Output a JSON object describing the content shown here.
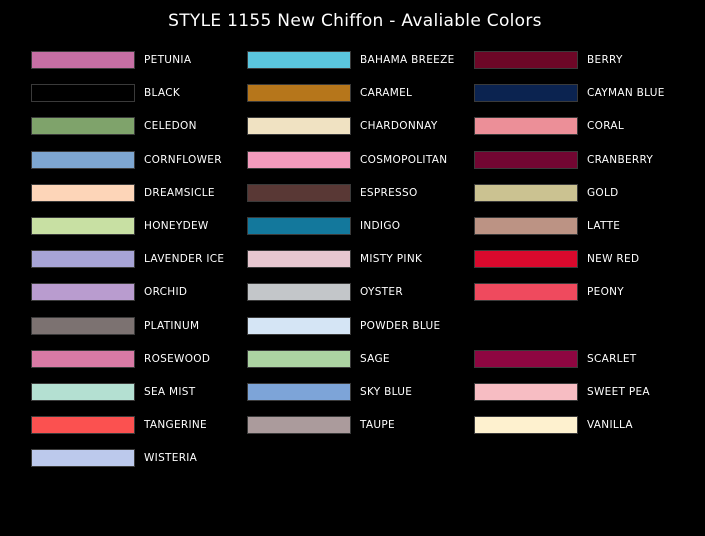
{
  "title": "STYLE 1155 New Chiffon - Avaliable Colors",
  "columns": [
    [
      {
        "name": "PETUNIA",
        "color": "#c66fa4"
      },
      {
        "name": "BLACK",
        "color": "#000000"
      },
      {
        "name": "CELEDON",
        "color": "#7fa36b"
      },
      {
        "name": "CORNFLOWER",
        "color": "#7ea6d0"
      },
      {
        "name": "DREAMSICLE",
        "color": "#fdd5b8"
      },
      {
        "name": "HONEYDEW",
        "color": "#c8e0a3"
      },
      {
        "name": "LAVENDER ICE",
        "color": "#a7a4d6"
      },
      {
        "name": "ORCHID",
        "color": "#b99ccf"
      },
      {
        "name": "PLATINUM",
        "color": "#7c7271"
      },
      {
        "name": "ROSEWOOD",
        "color": "#d87aa5"
      },
      {
        "name": "SEA MIST",
        "color": "#b4e0d2"
      },
      {
        "name": "TANGERINE",
        "color": "#fb5150"
      },
      {
        "name": "WISTERIA",
        "color": "#bcc9ec"
      }
    ],
    [
      {
        "name": "BAHAMA BREEZE",
        "color": "#5bc6de"
      },
      {
        "name": "CARAMEL",
        "color": "#b6761b"
      },
      {
        "name": "CHARDONNAY",
        "color": "#f0e2c2"
      },
      {
        "name": "COSMOPOLITAN",
        "color": "#f39bbd"
      },
      {
        "name": "ESPRESSO",
        "color": "#593835"
      },
      {
        "name": "INDIGO",
        "color": "#13789c"
      },
      {
        "name": "MISTY PINK",
        "color": "#e7c7d0"
      },
      {
        "name": "OYSTER",
        "color": "#c3c6c9"
      },
      {
        "name": "POWDER BLUE",
        "color": "#d5e5f5"
      },
      {
        "name": "SAGE",
        "color": "#acd3a2"
      },
      {
        "name": "SKY BLUE",
        "color": "#7da4d8"
      },
      {
        "name": "TAUPE",
        "color": "#ab9b9c"
      }
    ],
    [
      {
        "name": "BERRY",
        "color": "#6d0727"
      },
      {
        "name": "CAYMAN BLUE",
        "color": "#0b2350"
      },
      {
        "name": "CORAL",
        "color": "#ec8f98"
      },
      {
        "name": "CRANBERRY",
        "color": "#720632"
      },
      {
        "name": "GOLD",
        "color": "#cbc291"
      },
      {
        "name": "LATTE",
        "color": "#bc9384"
      },
      {
        "name": "NEW RED",
        "color": "#d9092d"
      },
      {
        "name": "PEONY",
        "color": "#ef4a5e"
      },
      {
        "name": "",
        "color": ""
      },
      {
        "name": "SCARLET",
        "color": "#8e0641"
      },
      {
        "name": "SWEET PEA",
        "color": "#f7bdc3"
      },
      {
        "name": "VANILLA",
        "color": "#fef1cf"
      }
    ]
  ]
}
